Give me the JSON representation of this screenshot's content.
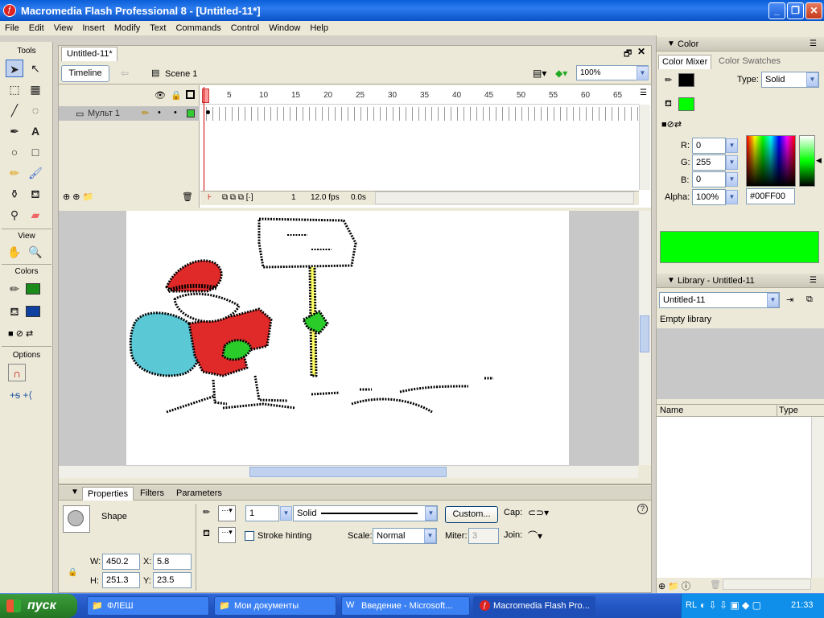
{
  "window": {
    "title": "Macromedia Flash Professional 8 - [Untitled-11*]"
  },
  "menu": [
    "File",
    "Edit",
    "View",
    "Insert",
    "Modify",
    "Text",
    "Commands",
    "Control",
    "Window",
    "Help"
  ],
  "tools": {
    "title": "Tools",
    "view_label": "View",
    "colors_label": "Colors",
    "options_label": "Options"
  },
  "document": {
    "tab": "Untitled-11*",
    "timeline_button": "Timeline",
    "scene": "Scene 1",
    "zoom": "100%"
  },
  "timeline": {
    "layer_name": "Мульт 1",
    "ruler": [
      "1",
      "5",
      "10",
      "15",
      "20",
      "25",
      "30",
      "35",
      "40",
      "45",
      "50",
      "55",
      "60",
      "65"
    ],
    "current_frame": "1",
    "fps": "12.0 fps",
    "time": "0.0s"
  },
  "properties": {
    "tabs": [
      "Properties",
      "Filters",
      "Parameters"
    ],
    "object_type": "Shape",
    "stroke_height": "1",
    "stroke_style": "Solid",
    "custom_button": "Custom...",
    "cap_label": "Cap:",
    "join_label": "Join:",
    "stroke_hinting": "Stroke hinting",
    "scale_label": "Scale:",
    "scale_value": "Normal",
    "miter_label": "Miter:",
    "miter_value": "3",
    "w_label": "W:",
    "w": "450.2",
    "h_label": "H:",
    "h": "251.3",
    "x_label": "X:",
    "x": "5.8",
    "y_label": "Y:",
    "y": "23.5"
  },
  "color_panel": {
    "title": "Color",
    "tabs": [
      "Color Mixer",
      "Color Swatches"
    ],
    "type_label": "Type:",
    "type_value": "Solid",
    "r_label": "R:",
    "r": "0",
    "g_label": "G:",
    "g": "255",
    "b_label": "B:",
    "b": "0",
    "alpha_label": "Alpha:",
    "alpha": "100%",
    "hex": "#00FF00",
    "fill_color": "#00ff00"
  },
  "library_panel": {
    "title": "Library - Untitled-11",
    "doc_select": "Untitled-11",
    "empty_text": "Empty library",
    "col_name": "Name",
    "col_type": "Type"
  },
  "taskbar": {
    "start": "пуск",
    "tasks": [
      "ФЛЕШ",
      "Мои документы",
      "Введение - Microsoft...",
      "Macromedia Flash Pro..."
    ],
    "lang": "RL",
    "clock": "21:33"
  }
}
